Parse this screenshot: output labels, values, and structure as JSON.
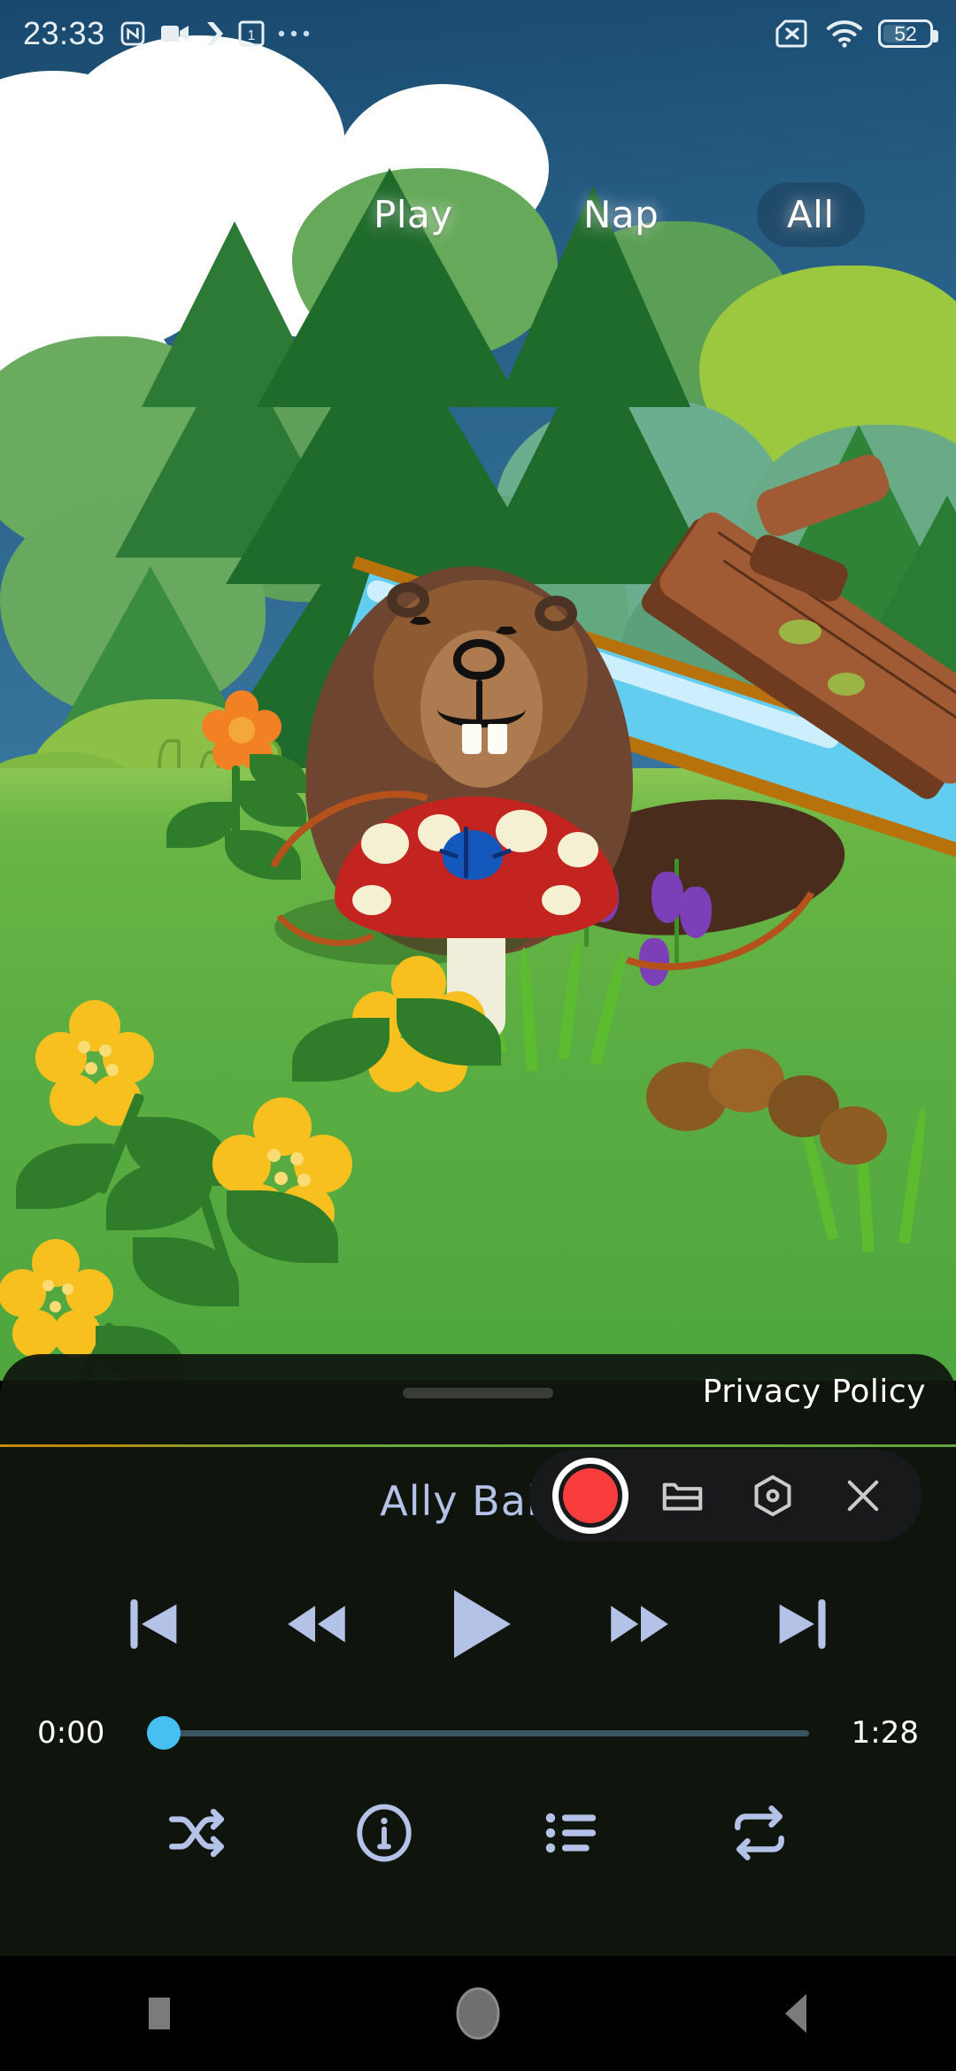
{
  "status_bar": {
    "time": "23:33",
    "battery_text": "52",
    "left_icons": [
      "nfc-icon",
      "screen-record-icon",
      "chevron-right-icon",
      "notification-count-icon",
      "overflow-dots-icon"
    ],
    "notification_count": "1",
    "right_icons": [
      "sim-card-off-icon",
      "wifi-icon",
      "battery-icon"
    ]
  },
  "tabs": [
    {
      "label": "Play",
      "selected": false
    },
    {
      "label": "Nap",
      "selected": false
    },
    {
      "label": "All",
      "selected": true
    }
  ],
  "player": {
    "privacy_label": "Privacy Policy",
    "song_title": "Ally Bally",
    "elapsed_time": "0:00",
    "total_time": "1:28",
    "progress_percent": 0,
    "transport": [
      {
        "name": "previous-track-button",
        "icon": "skip-previous-icon"
      },
      {
        "name": "rewind-button",
        "icon": "fast-rewind-icon"
      },
      {
        "name": "play-button",
        "icon": "play-icon"
      },
      {
        "name": "fast-forward-button",
        "icon": "fast-forward-icon"
      },
      {
        "name": "next-track-button",
        "icon": "skip-next-icon"
      }
    ],
    "options": [
      {
        "name": "shuffle-button",
        "icon": "shuffle-icon"
      },
      {
        "name": "info-button",
        "icon": "info-circle-icon"
      },
      {
        "name": "playlist-button",
        "icon": "list-icon"
      },
      {
        "name": "repeat-button",
        "icon": "repeat-icon"
      }
    ]
  },
  "recorder_overlay": {
    "record_button": "record-button",
    "icons": [
      {
        "name": "folder-button",
        "icon": "folder-icon"
      },
      {
        "name": "settings-button",
        "icon": "hexagon-settings-icon"
      },
      {
        "name": "close-button",
        "icon": "close-x-icon"
      }
    ]
  },
  "nav_bar": [
    {
      "name": "recents-button",
      "icon": "square-icon"
    },
    {
      "name": "home-button",
      "icon": "circle-icon"
    },
    {
      "name": "back-button",
      "icon": "triangle-back-icon"
    }
  ],
  "colors": {
    "accent_blue": "#45c0f0",
    "record_red": "#f93d3d",
    "control_blue": "#b4c2e8",
    "panel_bg": "#101610",
    "sky": "#245a80",
    "grass": "#5aad42"
  }
}
